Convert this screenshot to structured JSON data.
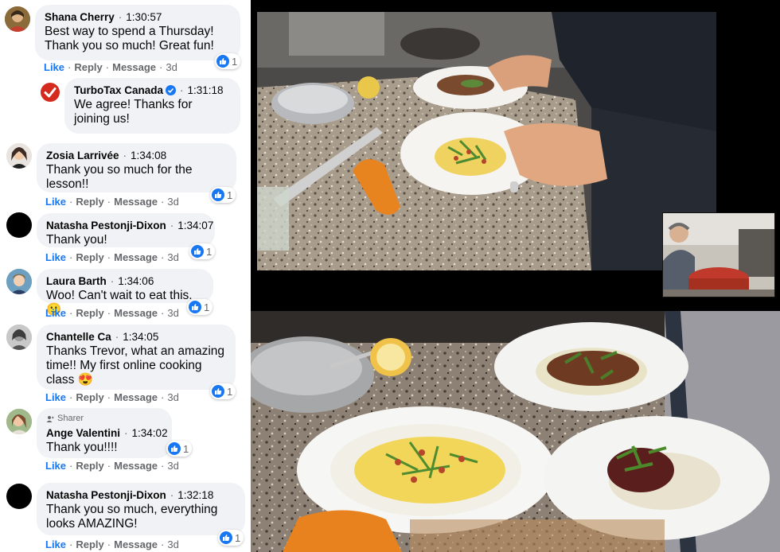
{
  "comments": [
    {
      "author": "Shana Cherry",
      "time": "1:30:57",
      "text": "Best way to spend a Thursday! Thank you so much! Great fun!",
      "actions": {
        "like": "Like",
        "reply": "Reply",
        "message": "Message",
        "age": "3d"
      },
      "reactions": "1",
      "avatar": "photo"
    },
    {
      "author": "TurboTax Canada",
      "time": "1:31:18",
      "text": "We agree! Thanks for joining us!",
      "verified": true,
      "actions": {
        "like": "Like",
        "reply": "Reply",
        "message": "Message",
        "age": "3d"
      }
    },
    {
      "author": "Zosia Larrivée",
      "time": "1:34:08",
      "text": "Thank you so much for the lesson!!",
      "actions": {
        "like": "Like",
        "reply": "Reply",
        "message": "Message",
        "age": "3d"
      },
      "reactions": "1",
      "avatar": "photo"
    },
    {
      "author": "Natasha Pestonji-Dixon",
      "time": "1:34:07",
      "text": "Thank you!",
      "actions": {
        "like": "Like",
        "reply": "Reply",
        "message": "Message",
        "age": "3d"
      },
      "reactions": "1",
      "avatar": "black"
    },
    {
      "author": "Laura Barth",
      "time": "1:34:06",
      "text": "Woo! Can't wait to eat this.",
      "emoji": "🙂",
      "actions": {
        "like": "Like",
        "reply": "Reply",
        "message": "Message",
        "age": "3d"
      },
      "reactions": "1",
      "avatar": "photo"
    },
    {
      "author": "Chantelle Ca",
      "time": "1:34:05",
      "text": "Thanks Trevor, what an amazing time!! My first online cooking class",
      "emoji": "😍",
      "actions": {
        "like": "Like",
        "reply": "Reply",
        "message": "Message",
        "age": "3d"
      },
      "reactions": "1",
      "avatar": "photo"
    },
    {
      "author": "Ange Valentini",
      "time": "1:34:02",
      "text": "Thank you!!!!",
      "badge": "Sharer",
      "actions": {
        "like": "Like",
        "reply": "Reply",
        "message": "Message",
        "age": "3d"
      },
      "reactions": "1",
      "avatar": "photo"
    },
    {
      "author": "Natasha Pestonji-Dixon",
      "time": "1:32:18",
      "text": "Thank you so much, everything looks AMAZING!",
      "actions": {
        "like": "Like",
        "reply": "Reply",
        "message": "Message",
        "age": "3d"
      },
      "reactions": "1",
      "avatar": "black"
    }
  ],
  "colors": {
    "like_blue": "#1877f2",
    "bubble_bg": "#f0f2f5",
    "meta_gray": "#65676b",
    "turbotax_red": "#d52b1e"
  },
  "video": {
    "main_feed": "chef plating pasta dishes",
    "pip_feed": "host self view",
    "bottom_feed": "three finished plates close-up"
  }
}
